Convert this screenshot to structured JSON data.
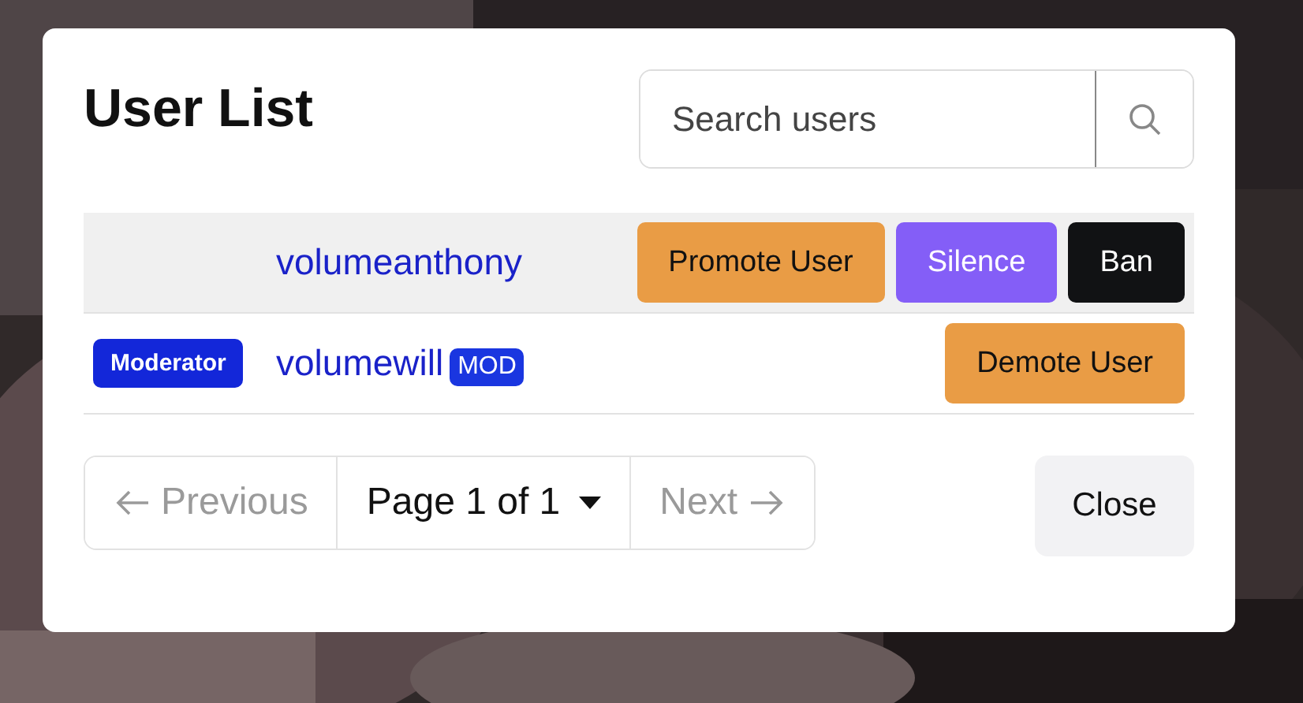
{
  "dialog": {
    "title": "User List",
    "search": {
      "placeholder": "Search users"
    },
    "users": [
      {
        "name": "volumeanthony",
        "highlighted": true,
        "actions": [
          {
            "label": "Promote User",
            "kind": "promote"
          },
          {
            "label": "Silence",
            "kind": "silence"
          },
          {
            "label": "Ban",
            "kind": "ban"
          }
        ]
      },
      {
        "name": "volumewill",
        "highlighted": false,
        "role_badge": "Moderator",
        "name_tag": "MOD",
        "actions": [
          {
            "label": "Demote User",
            "kind": "demote"
          }
        ]
      }
    ],
    "pagination": {
      "previous": {
        "label": "Previous",
        "disabled": true
      },
      "page": "Page 1 of 1",
      "next": {
        "label": "Next",
        "disabled": true
      }
    },
    "close_button": "Close"
  }
}
